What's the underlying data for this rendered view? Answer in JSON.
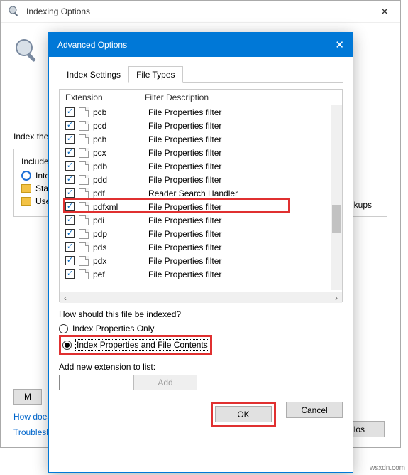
{
  "bg": {
    "title": "Indexing Options",
    "index_label": "Index the",
    "included_label": "Included",
    "items": [
      "Inter",
      "Star",
      "User"
    ],
    "backups": "kups",
    "btn1": "M",
    "link1": "How does",
    "link2": "Troublesh",
    "close_btn": "Clos"
  },
  "fg": {
    "title": "Advanced Options",
    "tabs": {
      "settings": "Index Settings",
      "filetypes": "File Types"
    },
    "col_ext": "Extension",
    "col_desc": "Filter Description",
    "rows": [
      {
        "ext": "pcb",
        "desc": "File Properties filter"
      },
      {
        "ext": "pcd",
        "desc": "File Properties filter"
      },
      {
        "ext": "pch",
        "desc": "File Properties filter"
      },
      {
        "ext": "pcx",
        "desc": "File Properties filter"
      },
      {
        "ext": "pdb",
        "desc": "File Properties filter"
      },
      {
        "ext": "pdd",
        "desc": "File Properties filter"
      },
      {
        "ext": "pdf",
        "desc": "Reader Search Handler"
      },
      {
        "ext": "pdfxml",
        "desc": "File Properties filter"
      },
      {
        "ext": "pdi",
        "desc": "File Properties filter"
      },
      {
        "ext": "pdp",
        "desc": "File Properties filter"
      },
      {
        "ext": "pds",
        "desc": "File Properties filter"
      },
      {
        "ext": "pdx",
        "desc": "File Properties filter"
      },
      {
        "ext": "pef",
        "desc": "File Properties filter"
      }
    ],
    "q_label": "How should this file be indexed?",
    "radio1": "Index Properties Only",
    "radio2": "Index Properties and File Contents",
    "add_label": "Add new extension to list:",
    "add_btn": "Add",
    "ok": "OK",
    "cancel": "Cancel"
  },
  "watermark": "wsxdn.com"
}
